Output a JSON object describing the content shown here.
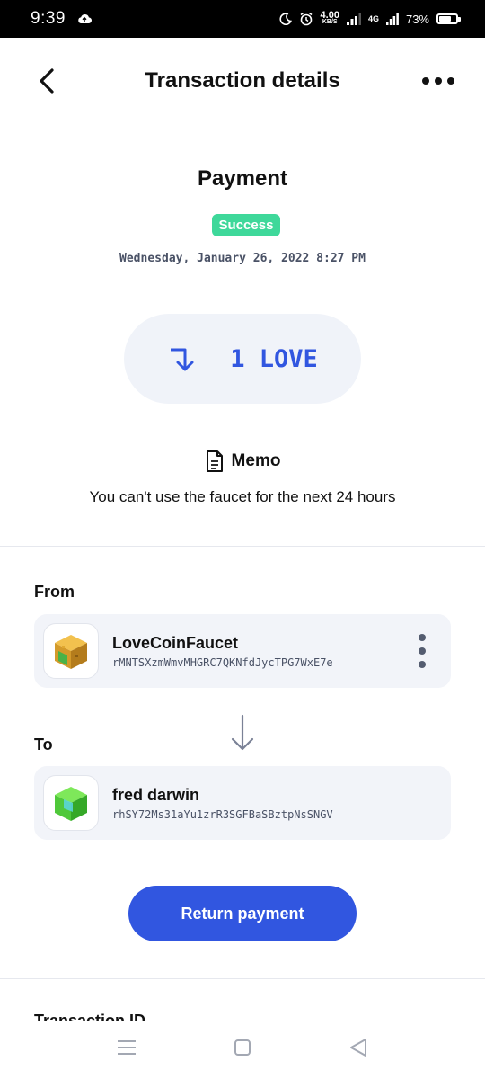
{
  "status_bar": {
    "time": "9:39",
    "speed_value": "4.00",
    "speed_unit": "KB/S",
    "network": "4G",
    "battery_percent": "73%",
    "battery_level": 0.73
  },
  "header": {
    "title": "Transaction details"
  },
  "transaction": {
    "type": "Payment",
    "status": "Success",
    "date": "Wednesday, January 26, 2022 8:27 PM",
    "amount": "1 LOVE",
    "memo_label": "Memo",
    "memo_text": "You can't use the faucet for the next 24 hours"
  },
  "from": {
    "label": "From",
    "name": "LoveCoinFaucet",
    "address": "rMNTSXzmWmvMHGRC7QKNfdJycTPG7WxE7e"
  },
  "to": {
    "label": "To",
    "name": "fred darwin",
    "address": "rhSY72Ms31aYu1zrR3SGFBaSBztpNsSNGV"
  },
  "actions": {
    "return_label": "Return payment"
  },
  "next_section": {
    "label": "Transaction ID"
  },
  "colors": {
    "accent": "#3156e0",
    "success": "#3ed89a",
    "card_bg": "#f2f4f9"
  }
}
